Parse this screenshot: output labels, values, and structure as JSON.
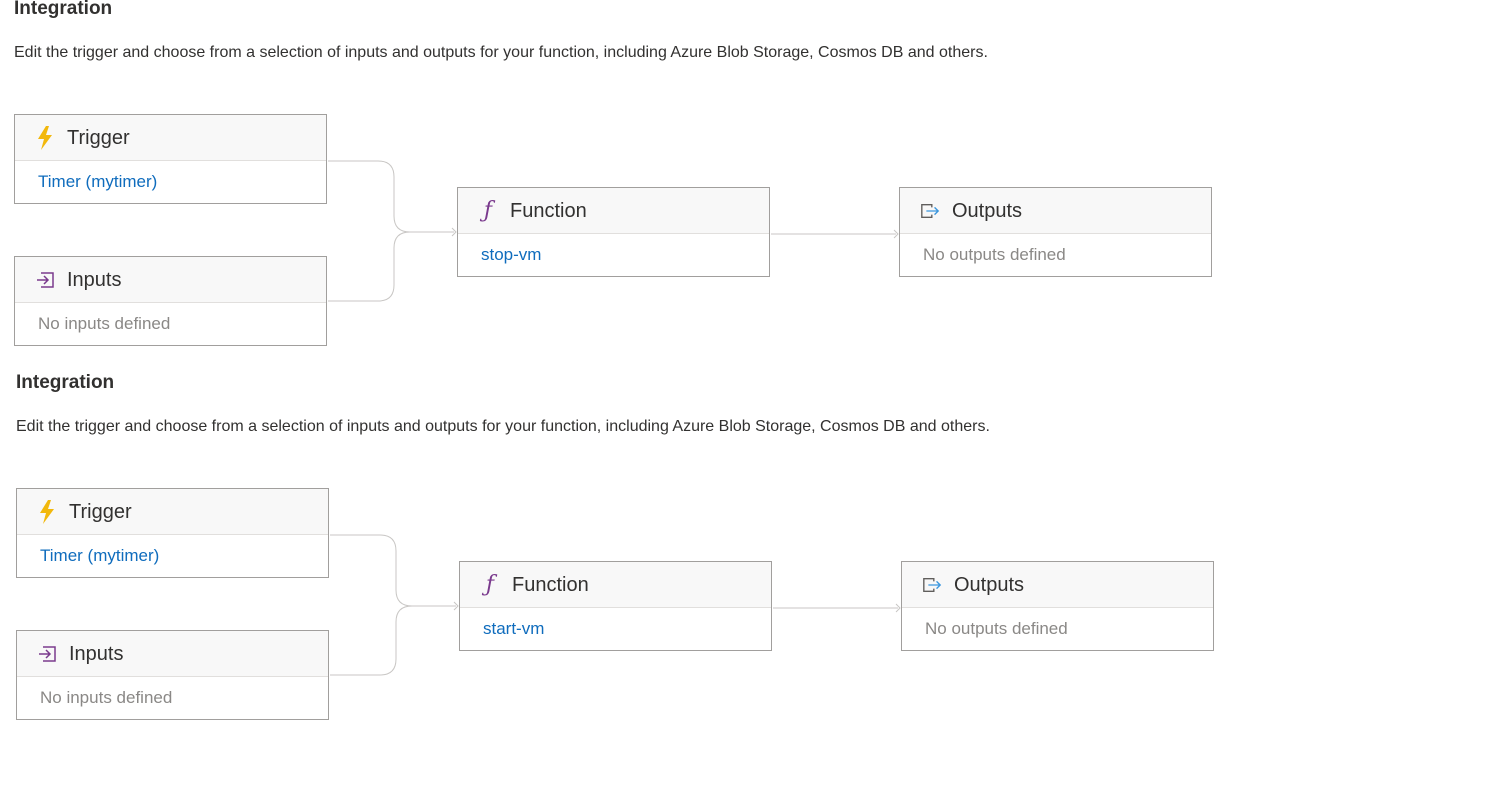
{
  "sections": [
    {
      "title": "Integration",
      "description": "Edit the trigger and choose from a selection of inputs and outputs for your function, including Azure Blob Storage, Cosmos DB and others.",
      "trigger": {
        "title": "Trigger",
        "value": "Timer (mytimer)",
        "icon": "lightning-icon"
      },
      "inputs": {
        "title": "Inputs",
        "value": "No inputs defined",
        "icon": "input-arrow-icon"
      },
      "function": {
        "title": "Function",
        "value": "stop-vm",
        "icon": "function-icon"
      },
      "outputs": {
        "title": "Outputs",
        "value": "No outputs defined",
        "icon": "output-arrow-icon"
      }
    },
    {
      "title": "Integration",
      "description": "Edit the trigger and choose from a selection of inputs and outputs for your function, including Azure Blob Storage, Cosmos DB and others.",
      "trigger": {
        "title": "Trigger",
        "value": "Timer (mytimer)",
        "icon": "lightning-icon"
      },
      "inputs": {
        "title": "Inputs",
        "value": "No inputs defined",
        "icon": "input-arrow-icon"
      },
      "function": {
        "title": "Function",
        "value": "start-vm",
        "icon": "function-icon"
      },
      "outputs": {
        "title": "Outputs",
        "value": "No outputs defined",
        "icon": "output-arrow-icon"
      }
    }
  ],
  "colors": {
    "link": "#0f6cbd",
    "lightning": "#f2b80c",
    "function_glyph": "#7a3a8d",
    "output_arrow": "#3a96dd",
    "input_arrow": "#7a3a8d",
    "connector": "#c8c6c4"
  }
}
